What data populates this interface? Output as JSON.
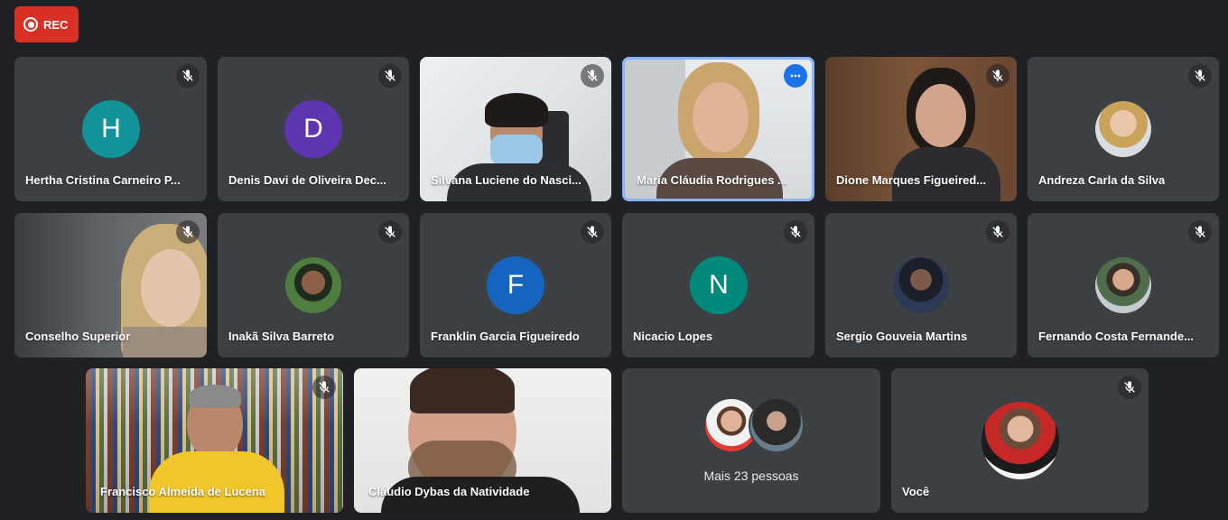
{
  "recording": {
    "label": "REC",
    "color": "#d93025"
  },
  "participants": [
    {
      "name": "Hertha Cristina Carneiro P...",
      "initial": "H",
      "avatar_color": "#12939a"
    },
    {
      "name": "Denis Davi de Oliveira Dec...",
      "initial": "D",
      "avatar_color": "#5e35b1"
    },
    {
      "name": "Silvana Luciene do Nasci..."
    },
    {
      "name": "Maria Cláudia Rodrigues ..."
    },
    {
      "name": "Dione Marques Figueired..."
    },
    {
      "name": "Andreza Carla da Silva"
    },
    {
      "name": "Conselho Superior"
    },
    {
      "name": "Inakã Silva Barreto"
    },
    {
      "name": "Franklin Garcia Figueiredo",
      "initial": "F",
      "avatar_color": "#1565c0"
    },
    {
      "name": "Nicacio Lopes",
      "initial": "N",
      "avatar_color": "#00897b"
    },
    {
      "name": "Sergio Gouveia Martins"
    },
    {
      "name": "Fernando Costa Fernande..."
    },
    {
      "name": "Francisco Almeida de Lucena"
    },
    {
      "name": "Cláudio Dybas da Natividade"
    }
  ],
  "more_people": {
    "label": "Mais 23 pessoas"
  },
  "self": {
    "label": "Você"
  },
  "icons": {
    "mic_off": "mic-off-icon",
    "more": "more-options-icon",
    "rec": "record-icon"
  }
}
